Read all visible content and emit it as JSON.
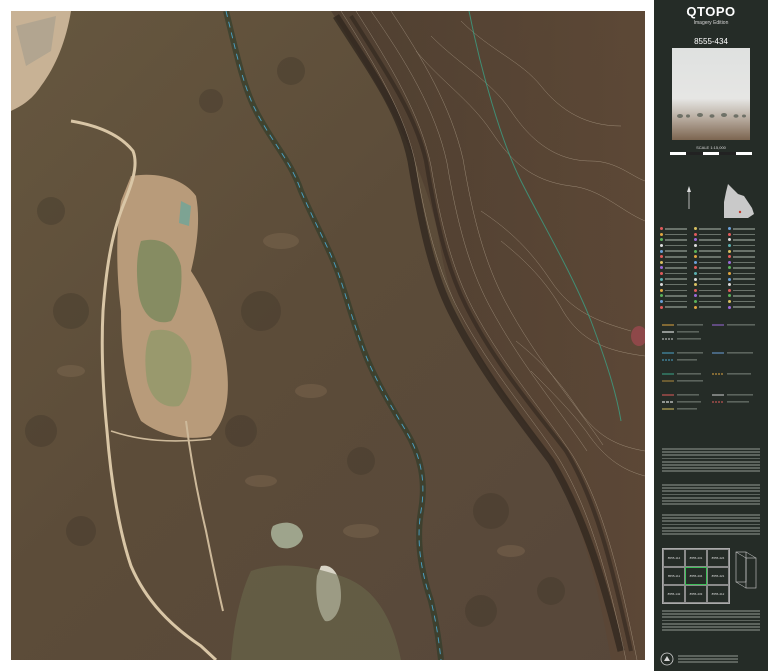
{
  "panel": {
    "title": "QTOPO",
    "subtitle": "Imagery Edition",
    "sheet_number": "8555-434",
    "scale": "SCALE 1:15,000"
  },
  "index_map": {
    "cells": [
      "8555-114",
      "8555-431",
      "8555-424",
      "8555-111",
      "8555-434",
      "8555-421",
      "8555-142",
      "8555-433",
      "8555-412"
    ],
    "current": "8555-434"
  },
  "colors": {
    "panel_bg": "#252c27",
    "frame": "#ffffff",
    "grid_line": "#3aa68a",
    "creek": "#4aa3c8",
    "current_sheet_outline": "#3fbf5a"
  },
  "icons": [
    "north-arrow-icon",
    "queensland-state-icon",
    "qld-government-logo-icon"
  ]
}
